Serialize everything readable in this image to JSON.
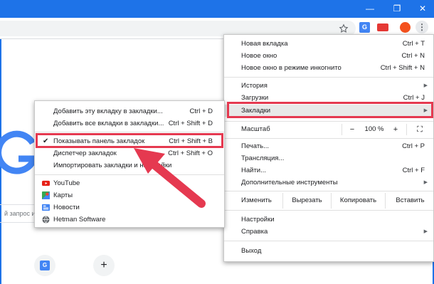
{
  "window": {
    "minimize_glyph": "—",
    "restore_glyph": "❐",
    "close_glyph": "✕",
    "title_color": "#1e73e8"
  },
  "toolbar": {
    "translate_ext_label": "G",
    "kebab_glyph": "⋮"
  },
  "page": {
    "search_placeholder": "й запрос и",
    "tile_translate_label": "G",
    "tile_add_glyph": "+"
  },
  "main_menu": {
    "items": [
      {
        "label": "Новая вкладка",
        "shortcut": "Ctrl + T"
      },
      {
        "label": "Новое окно",
        "shortcut": "Ctrl + N"
      },
      {
        "label": "Новое окно в режиме инкогнито",
        "shortcut": "Ctrl + Shift + N"
      },
      {
        "label": "История",
        "arrow": "▶"
      },
      {
        "label": "Загрузки",
        "shortcut": "Ctrl + J"
      },
      {
        "label": "Закладки",
        "arrow": "▶"
      },
      {
        "label": "Печать...",
        "shortcut": "Ctrl + P"
      },
      {
        "label": "Трансляция..."
      },
      {
        "label": "Найти...",
        "shortcut": "Ctrl + F"
      },
      {
        "label": "Дополнительные инструменты",
        "arrow": "▶"
      },
      {
        "label": "Настройки"
      },
      {
        "label": "Справка",
        "arrow": "▶"
      },
      {
        "label": "Выход"
      }
    ],
    "zoom": {
      "label": "Масштаб",
      "minus": "−",
      "value": "100 %",
      "plus": "+",
      "fullscreen": "⛶"
    },
    "edit": {
      "label": "Изменить",
      "cut": "Вырезать",
      "copy": "Копировать",
      "paste": "Вставить"
    }
  },
  "bookmarks_menu": {
    "items": [
      {
        "label": "Добавить эту вкладку в закладки...",
        "shortcut": "Ctrl + D"
      },
      {
        "label": "Добавить все вкладки в закладки...",
        "shortcut": "Ctrl + Shift + D"
      },
      {
        "label": "Показывать панель закладок",
        "shortcut": "Ctrl + Shift + B",
        "check": "✔"
      },
      {
        "label": "Диспетчер закладок",
        "shortcut": "Ctrl + Shift + O"
      },
      {
        "label": "Импортировать закладки и настройки"
      }
    ],
    "bookmarks": [
      {
        "label": "YouTube"
      },
      {
        "label": "Карты"
      },
      {
        "label": "Новости"
      },
      {
        "label": "Hetman Software"
      }
    ]
  },
  "colors": {
    "highlight": "#e53950",
    "accent": "#1e73e8"
  }
}
